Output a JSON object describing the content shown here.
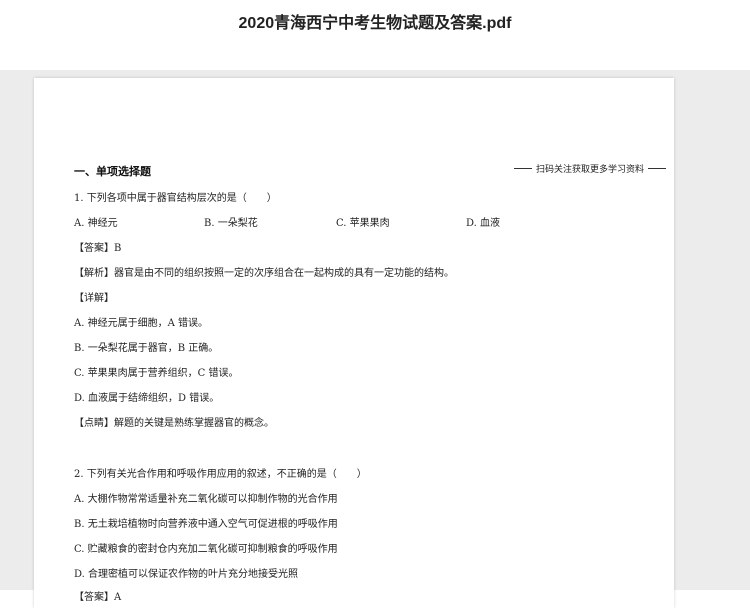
{
  "title": "2020青海西宁中考生物试题及答案.pdf",
  "section": "一、单项选择题",
  "promo": "扫码关注获取更多学习资料",
  "q1": {
    "question": "1. 下列各项中属于器官结构层次的是（　　）",
    "options": [
      "A.  神经元",
      "B.  一朵梨花",
      "C.  苹果果肉",
      "D.  血液"
    ],
    "answer": "【答案】B",
    "analysis": "【解析】器官是由不同的组织按照一定的次序组合在一起构成的具有一定功能的结构。",
    "detail_head": "【详解】",
    "details": [
      "A. 神经元属于细胞，A 错误。",
      "B. 一朵梨花属于器官，B 正确。",
      "C. 苹果果肉属于营养组织，C 错误。",
      "D. 血液属于结缔组织，D 错误。"
    ],
    "tip": "【点睛】解题的关键是熟练掌握器官的概念。"
  },
  "q2": {
    "question": "2. 下列有关光合作用和呼吸作用应用的叙述，不正确的是（　　）",
    "options": [
      "A.  大棚作物常常适量补充二氧化碳可以抑制作物的光合作用",
      "B.  无土栽培植物时向营养液中通入空气可促进根的呼吸作用",
      "C.  贮藏粮食的密封仓内充加二氧化碳可抑制粮食的呼吸作用",
      "D.  合理密植可以保证农作物的叶片充分地接受光照"
    ],
    "answer": "【答案】A"
  }
}
